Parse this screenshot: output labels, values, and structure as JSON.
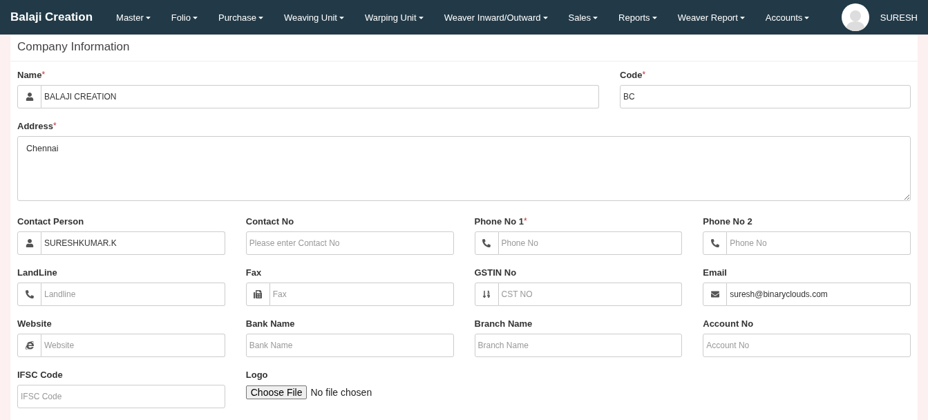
{
  "navbar": {
    "brand": "Balaji Creation",
    "menu": [
      {
        "label": "Master"
      },
      {
        "label": "Folio"
      },
      {
        "label": "Purchase"
      },
      {
        "label": "Weaving Unit"
      },
      {
        "label": "Warping Unit"
      },
      {
        "label": "Weaver Inward/Outward"
      },
      {
        "label": "Sales"
      },
      {
        "label": "Reports"
      },
      {
        "label": "Weaver Report"
      },
      {
        "label": "Accounts"
      }
    ],
    "user": "SURESH"
  },
  "panel": {
    "title": "Company Information",
    "rows": [
      [
        {
          "kind": "person",
          "label": "Name",
          "required_mark": "*",
          "value": "BALAJI CREATION"
        },
        {
          "kind": "plain",
          "label": "Code",
          "required_mark": "*",
          "value": "BC"
        }
      ],
      [
        {
          "kind": "textarea",
          "label": "Address",
          "required_mark": "*",
          "value": "Chennai"
        }
      ],
      [
        {
          "kind": "person",
          "label": "Contact Person",
          "value": "SURESHKUMAR.K"
        },
        {
          "kind": "plain",
          "label": "Contact No",
          "placeholder": "Please enter Contact No"
        },
        {
          "kind": "phone",
          "label": "Phone No 1",
          "required_mark": "*",
          "placeholder": "Phone No"
        },
        {
          "kind": "phone",
          "label": "Phone No 2",
          "placeholder": "Phone No"
        },
        {
          "kind": "phone",
          "label": "LandLine",
          "placeholder": "Landline"
        },
        {
          "kind": "fax",
          "label": "Fax",
          "placeholder": "Fax"
        },
        {
          "kind": "number",
          "label": "GSTIN No",
          "placeholder": "CST NO"
        },
        {
          "kind": "email",
          "label": "Email",
          "value": "suresh@binaryclouds.com"
        },
        {
          "kind": "web",
          "label": "Website",
          "placeholder": "Website"
        },
        {
          "kind": "plain",
          "label": "Bank Name",
          "placeholder": "Bank Name"
        },
        {
          "kind": "plain",
          "label": "Branch Name",
          "placeholder": "Branch Name"
        },
        {
          "kind": "plain",
          "label": "Account No",
          "placeholder": "Account No"
        },
        {
          "kind": "plain",
          "label": "IFSC Code",
          "placeholder": "IFSC Code"
        },
        {
          "kind": "file",
          "label": "Logo",
          "button": "Choose File",
          "status": "No file chosen"
        }
      ]
    ]
  }
}
